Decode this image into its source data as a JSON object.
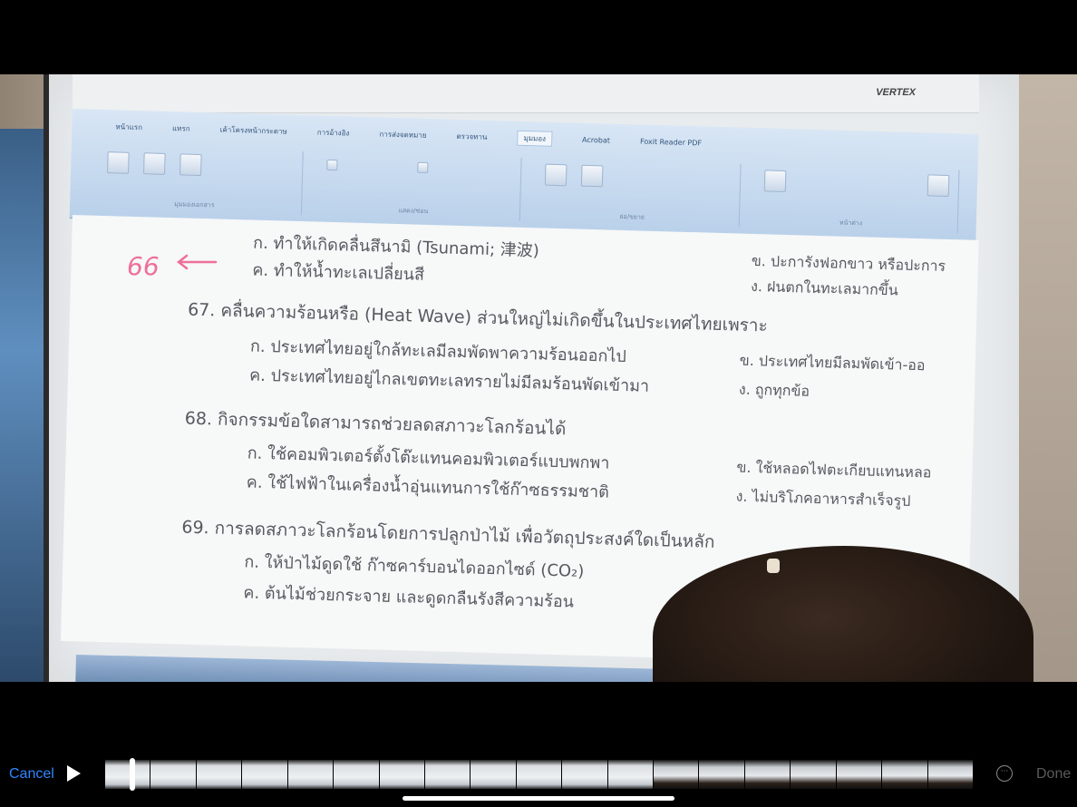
{
  "photo": {
    "projector_brand": "VERTEX",
    "word_ribbon": {
      "tabs": [
        "หน้าแรก",
        "แทรก",
        "เค้าโครงหน้ากระดาษ",
        "การอ้างอิง",
        "การส่งจดหมาย",
        "ตรวจทาน",
        "มุมมอง",
        "Acrobat",
        "Foxit Reader PDF"
      ],
      "active_tab": "มุมมอง",
      "groups": [
        "มุมมองเอกสาร",
        "แสดง/ซ่อน",
        "ย่อ/ขยาย",
        "หน้าต่าง"
      ]
    },
    "annotation": {
      "number": "66",
      "arrow": "←"
    },
    "document": {
      "lines": [
        {
          "kind": "opt",
          "text": "ก. ทำให้เกิดคลื่นสึนามิ (Tsunami; 津波)"
        },
        {
          "kind": "opt",
          "text": "ข. ปะการังฟอกขาว หรือปะการ"
        },
        {
          "kind": "opt",
          "text": "ค. ทำให้น้ำทะเลเปลี่ยนสี"
        },
        {
          "kind": "opt",
          "text": "ง. ฝนตกในทะเลมากขึ้น"
        },
        {
          "kind": "q",
          "text": "67. คลื่นความร้อนหรือ (Heat Wave) ส่วนใหญ่ไม่เกิดขึ้นในประเทศไทยเพราะ"
        },
        {
          "kind": "opt",
          "text": "ก. ประเทศไทยอยู่ใกล้ทะเลมีลมพัดพาความร้อนออกไป"
        },
        {
          "kind": "opt",
          "text": "ข. ประเทศไทยมีลมพัดเข้า-ออ"
        },
        {
          "kind": "opt",
          "text": "ค. ประเทศไทยอยู่ไกลเขตทะเลทรายไม่มีลมร้อนพัดเข้ามา"
        },
        {
          "kind": "opt",
          "text": "ง. ถูกทุกข้อ"
        },
        {
          "kind": "q",
          "text": "68. กิจกรรมข้อใดสามารถช่วยลดสภาวะโลกร้อนได้"
        },
        {
          "kind": "opt",
          "text": "ก. ใช้คอมพิวเตอร์ตั้งโต๊ะแทนคอมพิวเตอร์แบบพกพา"
        },
        {
          "kind": "opt",
          "text": "ข. ใช้หลอดไฟตะเกียบแทนหลอ"
        },
        {
          "kind": "opt",
          "text": "ค. ใช้ไฟฟ้าในเครื่องน้ำอุ่นแทนการใช้ก๊าซธรรมชาติ"
        },
        {
          "kind": "opt",
          "text": "ง. ไม่บริโภคอาหารสำเร็จรูป"
        },
        {
          "kind": "q",
          "text": "69. การลดสภาวะโลกร้อนโดยการปลูกป่าไม้ เพื่อวัตถุประสงค์ใดเป็นหลัก"
        },
        {
          "kind": "opt",
          "text": "ก. ให้ป่าไม้ดูดใช้ ก๊าซคาร์บอนไดออกไซด์ (CO₂)"
        },
        {
          "kind": "opt",
          "text": "ค. ต้นไม้ช่วยกระจาย และดูดกลืนรังสีความร้อน"
        }
      ]
    }
  },
  "controls": {
    "cancel_label": "Cancel",
    "done_label": "Done",
    "more_icon_text": "···",
    "filmstrip_frames": 19
  }
}
